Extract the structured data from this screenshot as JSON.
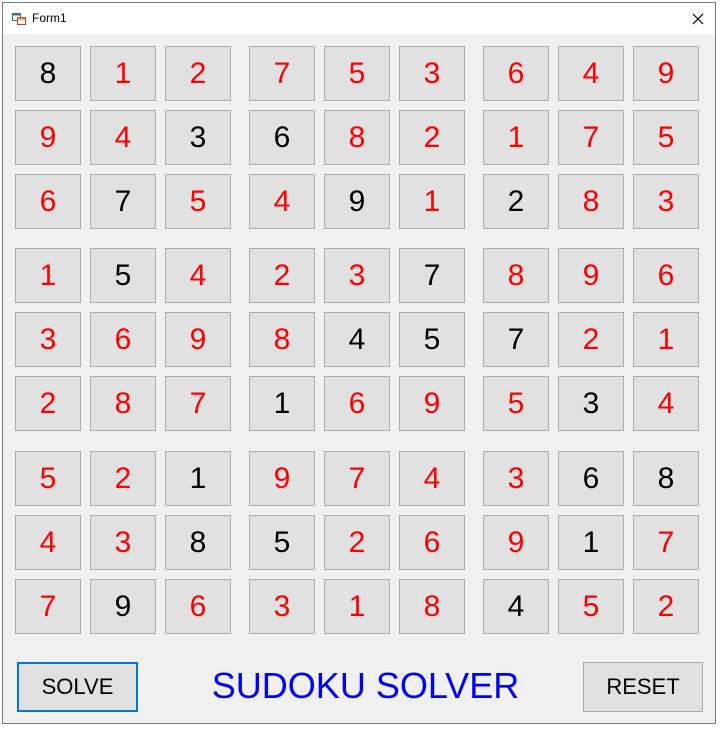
{
  "window": {
    "title": "Form1"
  },
  "sudoku": {
    "rows": [
      [
        "8",
        "1",
        "2",
        "7",
        "5",
        "3",
        "6",
        "4",
        "9"
      ],
      [
        "9",
        "4",
        "3",
        "6",
        "8",
        "2",
        "1",
        "7",
        "5"
      ],
      [
        "6",
        "7",
        "5",
        "4",
        "9",
        "1",
        "2",
        "8",
        "3"
      ],
      [
        "1",
        "5",
        "4",
        "2",
        "3",
        "7",
        "8",
        "9",
        "6"
      ],
      [
        "3",
        "6",
        "9",
        "8",
        "4",
        "5",
        "7",
        "2",
        "1"
      ],
      [
        "2",
        "8",
        "7",
        "1",
        "6",
        "9",
        "5",
        "3",
        "4"
      ],
      [
        "5",
        "2",
        "1",
        "9",
        "7",
        "4",
        "3",
        "6",
        "8"
      ],
      [
        "4",
        "3",
        "8",
        "5",
        "2",
        "6",
        "9",
        "1",
        "7"
      ],
      [
        "7",
        "9",
        "6",
        "3",
        "1",
        "8",
        "4",
        "5",
        "2"
      ]
    ],
    "given": [
      [
        1,
        0,
        0,
        0,
        0,
        0,
        0,
        0,
        0
      ],
      [
        0,
        0,
        1,
        1,
        0,
        0,
        0,
        0,
        0
      ],
      [
        0,
        1,
        0,
        0,
        1,
        0,
        1,
        0,
        0
      ],
      [
        0,
        1,
        0,
        0,
        0,
        1,
        0,
        0,
        0
      ],
      [
        0,
        0,
        0,
        0,
        1,
        1,
        1,
        0,
        0
      ],
      [
        0,
        0,
        0,
        1,
        0,
        0,
        0,
        1,
        0
      ],
      [
        0,
        0,
        1,
        0,
        0,
        0,
        0,
        1,
        1
      ],
      [
        0,
        0,
        1,
        1,
        0,
        0,
        0,
        1,
        0
      ],
      [
        0,
        1,
        0,
        0,
        0,
        0,
        1,
        0,
        0
      ]
    ],
    "colors": {
      "given": "#000000",
      "solved": "#ff0000"
    }
  },
  "buttons": {
    "solve_label": "SOLVE",
    "reset_label": "RESET"
  },
  "heading": {
    "text": "SUDOKU SOLVER",
    "color": "#0000ff"
  }
}
